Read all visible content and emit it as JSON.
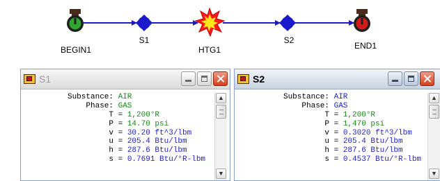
{
  "flow": {
    "nodes": [
      {
        "id": "begin",
        "label": "BEGIN1"
      },
      {
        "id": "s1",
        "label": "S1"
      },
      {
        "id": "htg",
        "label": "HTG1"
      },
      {
        "id": "s2",
        "label": "S2"
      },
      {
        "id": "end",
        "label": "END1"
      }
    ],
    "line_color": "#1a1acc"
  },
  "windows": [
    {
      "title": "S1",
      "active": false,
      "properties": [
        {
          "key": "Substance:",
          "sep": " ",
          "value": "AIR",
          "color": "green"
        },
        {
          "key": "Phase:",
          "sep": " ",
          "value": "GAS",
          "color": "green"
        },
        {
          "key": "T",
          "sep": " = ",
          "value": "1,200°R",
          "color": "green"
        },
        {
          "key": "P",
          "sep": " = ",
          "value": "14.70 psi",
          "color": "green"
        },
        {
          "key": "v",
          "sep": " = ",
          "value": "30.20 ft^3/lbm",
          "color": "blue"
        },
        {
          "key": "u",
          "sep": " = ",
          "value": "205.4 Btu/lbm",
          "color": "blue"
        },
        {
          "key": "h",
          "sep": " = ",
          "value": "287.6 Btu/lbm",
          "color": "blue"
        },
        {
          "key": "s",
          "sep": " = ",
          "value": "0.7691 Btu/°R-lbm",
          "color": "blue"
        }
      ]
    },
    {
      "title": "S2",
      "active": true,
      "properties": [
        {
          "key": "Substance:",
          "sep": " ",
          "value": "AIR",
          "color": "blue"
        },
        {
          "key": "Phase:",
          "sep": " ",
          "value": "GAS",
          "color": "blue"
        },
        {
          "key": "T",
          "sep": " = ",
          "value": "1,200°R",
          "color": "green"
        },
        {
          "key": "P",
          "sep": " = ",
          "value": "1,470 psi",
          "color": "green"
        },
        {
          "key": "v",
          "sep": " = ",
          "value": "0.3020 ft^3/lbm",
          "color": "blue"
        },
        {
          "key": "u",
          "sep": " = ",
          "value": "205.4 Btu/lbm",
          "color": "blue"
        },
        {
          "key": "h",
          "sep": " = ",
          "value": "287.6 Btu/lbm",
          "color": "blue"
        },
        {
          "key": "s",
          "sep": " = ",
          "value": "0.4537 Btu/°R-lbm",
          "color": "blue"
        }
      ]
    }
  ],
  "colors": {
    "green": "#1a8a1a",
    "blue": "#2222cc"
  }
}
